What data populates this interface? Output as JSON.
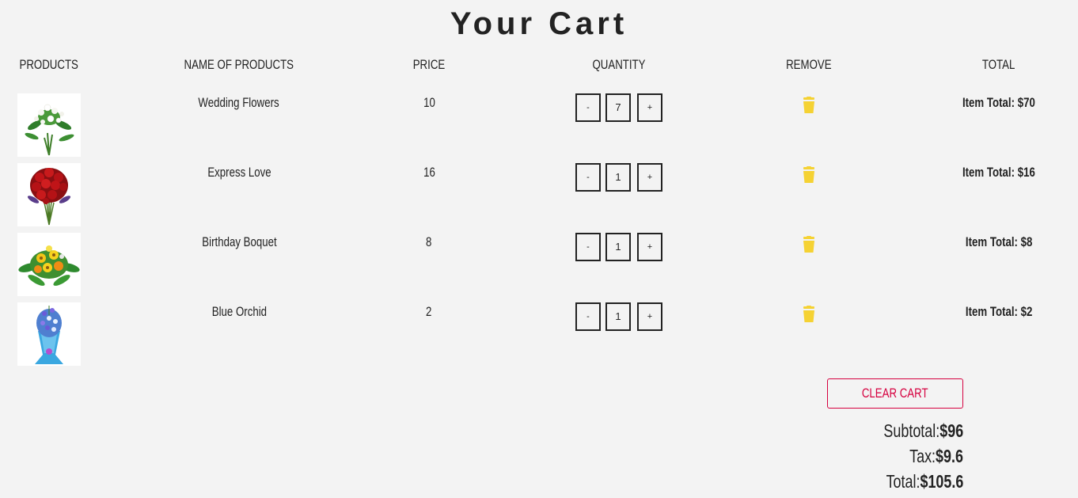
{
  "page": {
    "title": "Your Cart"
  },
  "columns": {
    "products": "PRODUCTS",
    "name": "NAME OF PRODUCTS",
    "price": "PRICE",
    "quantity": "QUANTITY",
    "remove": "REMOVE",
    "total": "TOTAL"
  },
  "items": [
    {
      "image": "white-flower-bouquet-image",
      "name": "Wedding Flowers",
      "price": "10",
      "decrement_label": "-",
      "quantity": "7",
      "increment_label": "+",
      "remove_icon": "trash-icon",
      "total": "Item Total: $70"
    },
    {
      "image": "red-rose-bouquet-image",
      "name": "Express Love",
      "price": "16",
      "decrement_label": "-",
      "quantity": "1",
      "increment_label": "+",
      "remove_icon": "trash-icon",
      "total": "Item Total: $16"
    },
    {
      "image": "yellow-flower-bouquet-image",
      "name": "Birthday Boquet",
      "price": "8",
      "decrement_label": "-",
      "quantity": "1",
      "increment_label": "+",
      "remove_icon": "trash-icon",
      "total": "Item Total: $8"
    },
    {
      "image": "blue-orchid-bouquet-image",
      "name": "Blue Orchid",
      "price": "2",
      "decrement_label": "-",
      "quantity": "1",
      "increment_label": "+",
      "remove_icon": "trash-icon",
      "total": "Item Total: $2"
    }
  ],
  "actions": {
    "clear_cart": "CLEAR CART"
  },
  "summary": {
    "subtotal_label": "Subtotal:",
    "subtotal_value": "$96",
    "tax_label": "Tax:",
    "tax_value": "$9.6",
    "total_label": "Total:",
    "total_value": "$105.6"
  },
  "colors": {
    "background": "#f3f3f3",
    "text": "#222222",
    "trash_icon": "#f5d233",
    "clear_cart_accent": "#d6003f"
  }
}
